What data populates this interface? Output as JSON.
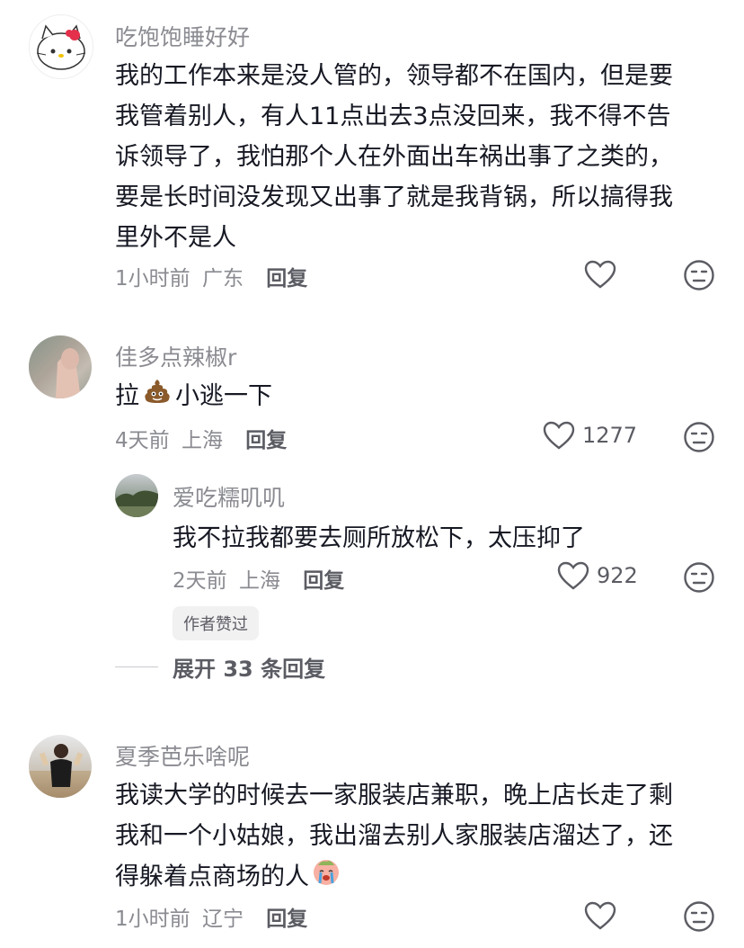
{
  "comments": [
    {
      "username": "吃饱饱睡好好",
      "lines": [
        "我的工作本来是没人管的，领导都不在国内，但是要",
        "我管着别人，有人11点出去3点没回来，我不得不告",
        "诉领导了，我怕那个人在外面出车祸出事了之类的，",
        "要是长时间没发现又出事了就是我背锅，所以搞得我",
        "里外不是人"
      ],
      "time": "1小时前",
      "location": "广东",
      "reply_label": "回复"
    },
    {
      "username": "佳多点辣椒r",
      "text_before": "拉",
      "emoji": "poop-emoji",
      "text_after": "小逃一下",
      "time": "4天前",
      "location": "上海",
      "reply_label": "回复",
      "likes": "1277",
      "sub_reply": {
        "username": "爱吃糯叽叽",
        "text": "我不拉我都要去厕所放松下，太压抑了",
        "time": "2天前",
        "location": "上海",
        "reply_label": "回复",
        "likes": "922",
        "badge": "作者赞过"
      },
      "expand_label": "展开 33 条回复"
    },
    {
      "username": "夏季芭乐啥呢",
      "lines": [
        "我读大学的时候去一家服装店兼职，晚上店长走了剩",
        "我和一个小姑娘，我出溜去别人家服装店溜达了，还",
        "得躲着点商场的人"
      ],
      "emoji": "crying-face-emoji",
      "time": "1小时前",
      "location": "辽宁",
      "reply_label": "回复"
    }
  ],
  "colors": {
    "text": "#161823",
    "secondary": "#8a8b91",
    "action": "#5b5c63"
  }
}
